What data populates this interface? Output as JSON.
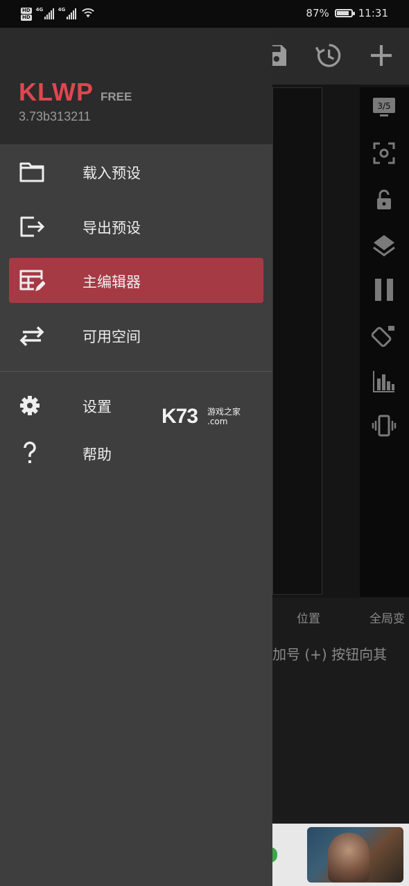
{
  "status_bar": {
    "hd_badges": [
      "HD",
      "HD"
    ],
    "network_type": "4G",
    "network_type_2": "4G",
    "battery_percent": "87%",
    "battery_level": 0.87,
    "time": "11:31"
  },
  "background_app": {
    "toolbar_icons": [
      "save-icon",
      "history-icon",
      "add-icon"
    ],
    "rail_icons": [
      "screen-preview-icon",
      "focus-icon",
      "lock-icon",
      "layers-icon",
      "pause-icon",
      "rotate-lock-icon",
      "equalizer-icon",
      "vibrate-icon"
    ],
    "screen_badge": "3/5",
    "tabs": [
      "位置",
      "全局变"
    ],
    "hint_text": "加号 (+) 按钮向其"
  },
  "drawer": {
    "app_name": "KLWP",
    "edition": "FREE",
    "version": "3.73b313211",
    "menu_primary": [
      {
        "label": "载入预设",
        "icon": "folder-icon",
        "active": false
      },
      {
        "label": "导出预设",
        "icon": "export-icon",
        "active": false
      },
      {
        "label": "主编辑器",
        "icon": "editor-icon",
        "active": true
      },
      {
        "label": "可用空间",
        "icon": "swap-icon",
        "active": false
      }
    ],
    "menu_secondary": [
      {
        "label": "设置",
        "icon": "gear-icon"
      },
      {
        "label": "帮助",
        "icon": "help-icon"
      }
    ],
    "accent_color": "#e0464f",
    "active_color": "#a53a45"
  },
  "watermark": {
    "logo": "K73",
    "line1": "游戏之家",
    "line2": ".com"
  }
}
